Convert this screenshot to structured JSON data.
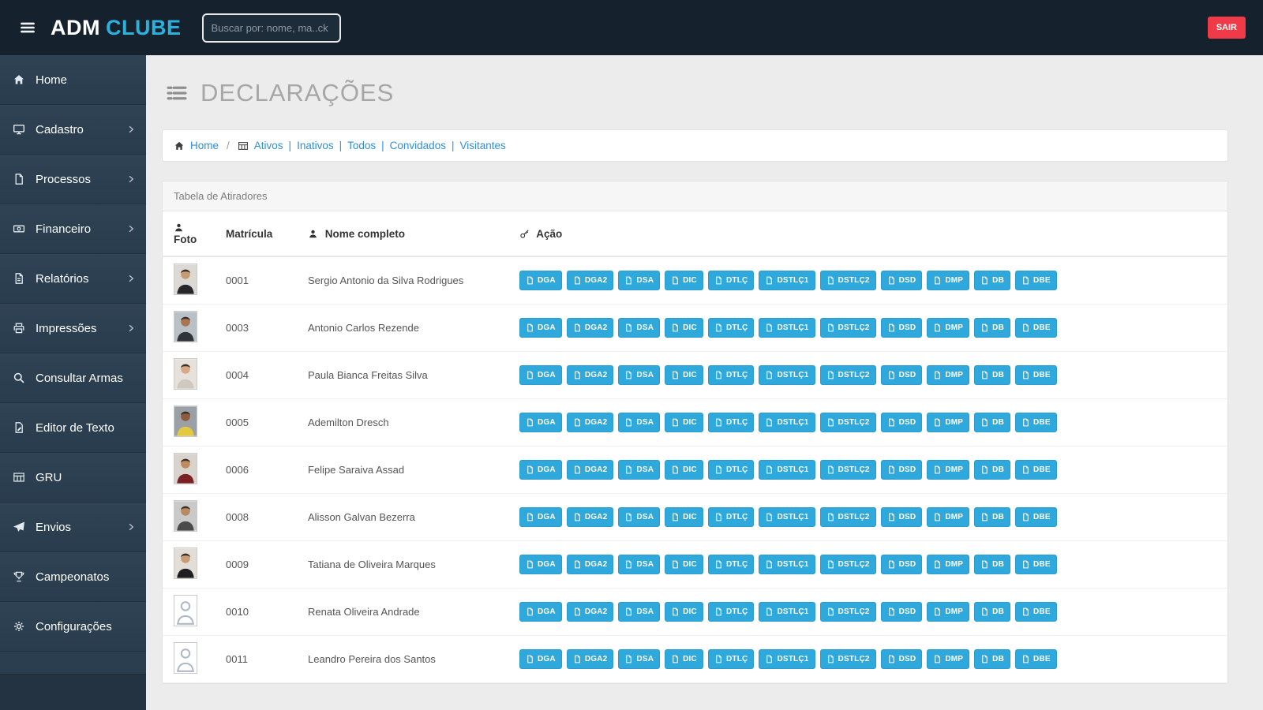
{
  "topbar": {
    "brand_adm": "ADM",
    "brand_clube": "CLUBE",
    "search_placeholder": "Buscar por: nome, ma..ck",
    "logout_label": "SAIR"
  },
  "sidebar": {
    "items": [
      {
        "label": "Home",
        "icon": "home",
        "chevron": false
      },
      {
        "label": "Cadastro",
        "icon": "monitor",
        "chevron": true
      },
      {
        "label": "Processos",
        "icon": "file",
        "chevron": true
      },
      {
        "label": "Financeiro",
        "icon": "money",
        "chevron": true
      },
      {
        "label": "Relatórios",
        "icon": "report",
        "chevron": true
      },
      {
        "label": "Impressões",
        "icon": "printer",
        "chevron": true
      },
      {
        "label": "Consultar Armas",
        "icon": "search",
        "chevron": false
      },
      {
        "label": "Editor de Texto",
        "icon": "doc-edit",
        "chevron": false
      },
      {
        "label": "GRU",
        "icon": "grid",
        "chevron": false
      },
      {
        "label": "Envios",
        "icon": "send",
        "chevron": true
      },
      {
        "label": "Campeonatos",
        "icon": "trophy",
        "chevron": false
      },
      {
        "label": "Configurações",
        "icon": "gear",
        "chevron": false
      }
    ]
  },
  "page": {
    "title": "DECLARAÇÕES"
  },
  "breadcrumb": {
    "home": "Home",
    "separator": "/",
    "divider": "|",
    "links": [
      "Ativos",
      "Inativos",
      "Todos",
      "Convidados",
      "Visitantes"
    ]
  },
  "panel": {
    "title": "Tabela de Atiradores"
  },
  "table": {
    "columns": [
      "Foto",
      "Matrícula",
      "Nome completo",
      "Ação"
    ],
    "actions": [
      "DGA",
      "DGA2",
      "DSA",
      "DIC",
      "DTLÇ",
      "DSTLÇ1",
      "DSTLÇ2",
      "DSD",
      "DMP",
      "DB",
      "DBE"
    ],
    "rows": [
      {
        "matricula": "0001",
        "nome": "Sergio Antonio da Silva Rodrigues",
        "photo": {
          "type": "photo",
          "bg": "#dcd9d4",
          "skin": "#c89b72",
          "shirt": "#26262b"
        }
      },
      {
        "matricula": "0003",
        "nome": "Antonio Carlos Rezende",
        "photo": {
          "type": "photo",
          "bg": "#b9c0c6",
          "skin": "#a9744f",
          "shirt": "#30343a"
        }
      },
      {
        "matricula": "0004",
        "nome": "Paula Bianca Freitas Silva",
        "photo": {
          "type": "photo",
          "bg": "#e6e1da",
          "skin": "#d9a886",
          "shirt": "#cfc8bf"
        }
      },
      {
        "matricula": "0005",
        "nome": "Ademilton Dresch",
        "photo": {
          "type": "photo",
          "bg": "#9aa0a6",
          "skin": "#8d5a3b",
          "shirt": "#e3c93f"
        }
      },
      {
        "matricula": "0006",
        "nome": "Felipe Saraiva Assad",
        "photo": {
          "type": "photo",
          "bg": "#d8d3cd",
          "skin": "#c08a5f",
          "shirt": "#7a1f24"
        }
      },
      {
        "matricula": "0008",
        "nome": "Alisson Galvan Bezerra",
        "photo": {
          "type": "photo",
          "bg": "#c9c9c9",
          "skin": "#b98a62",
          "shirt": "#4a4a4a"
        }
      },
      {
        "matricula": "0009",
        "nome": "Tatiana de Oliveira Marques",
        "photo": {
          "type": "photo",
          "bg": "#e2ddd6",
          "skin": "#c99b76",
          "shirt": "#1f1f1f"
        }
      },
      {
        "matricula": "0010",
        "nome": "Renata Oliveira Andrade",
        "photo": {
          "type": "placeholder"
        }
      },
      {
        "matricula": "0011",
        "nome": "Leandro Pereira dos Santos",
        "photo": {
          "type": "placeholder"
        }
      }
    ]
  },
  "colors": {
    "accent_blue": "#2fa8dc",
    "danger_red": "#ee3b47",
    "link_blue": "#2f8fd8",
    "sidebar_bg": "#2b3e50",
    "topbar_bg": "#15222d"
  }
}
